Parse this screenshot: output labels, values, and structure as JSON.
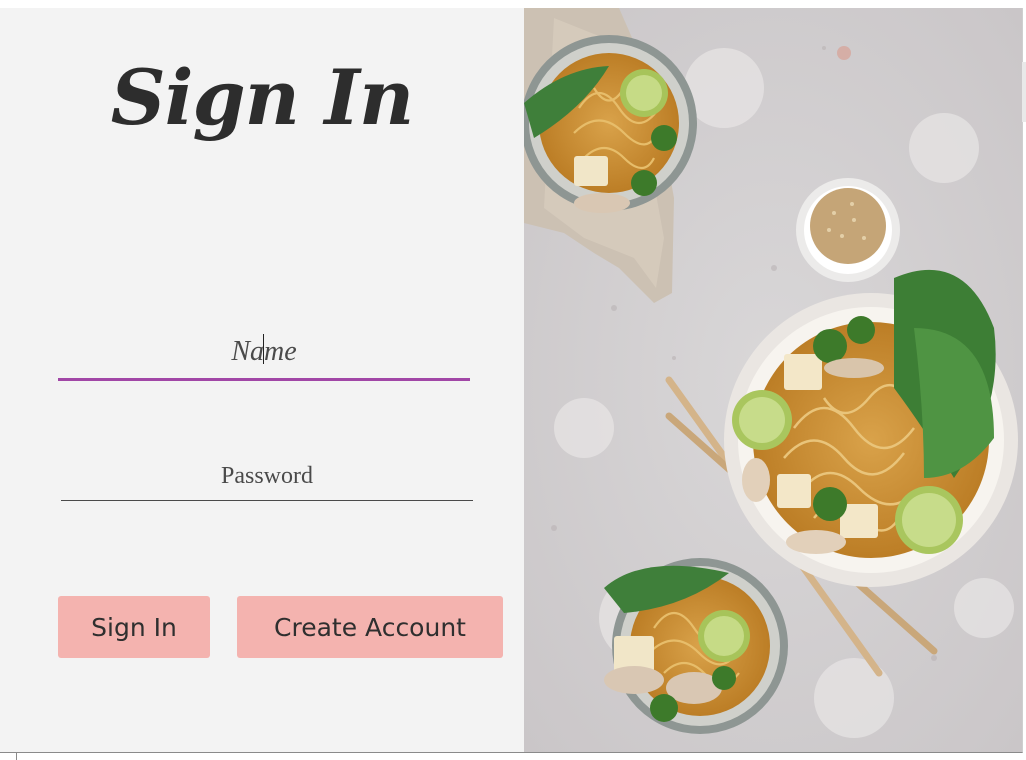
{
  "signin_form": {
    "title": "Sign In",
    "name_field": {
      "placeholder": "Name",
      "value": ""
    },
    "password_field": {
      "placeholder": "Password",
      "value": ""
    },
    "sign_in_button_label": "Sign In",
    "create_account_button_label": "Create Account"
  },
  "colors": {
    "panel_background": "#f3f3f3",
    "button_background": "#f4b3af",
    "focused_underline": "#a146a6",
    "title_text": "#2d2d2d"
  },
  "hero_image": {
    "subject": "bowls of ramen noodle soup with tofu, broccoli, bok choy, lime and sesame seeds on a stone surface"
  }
}
